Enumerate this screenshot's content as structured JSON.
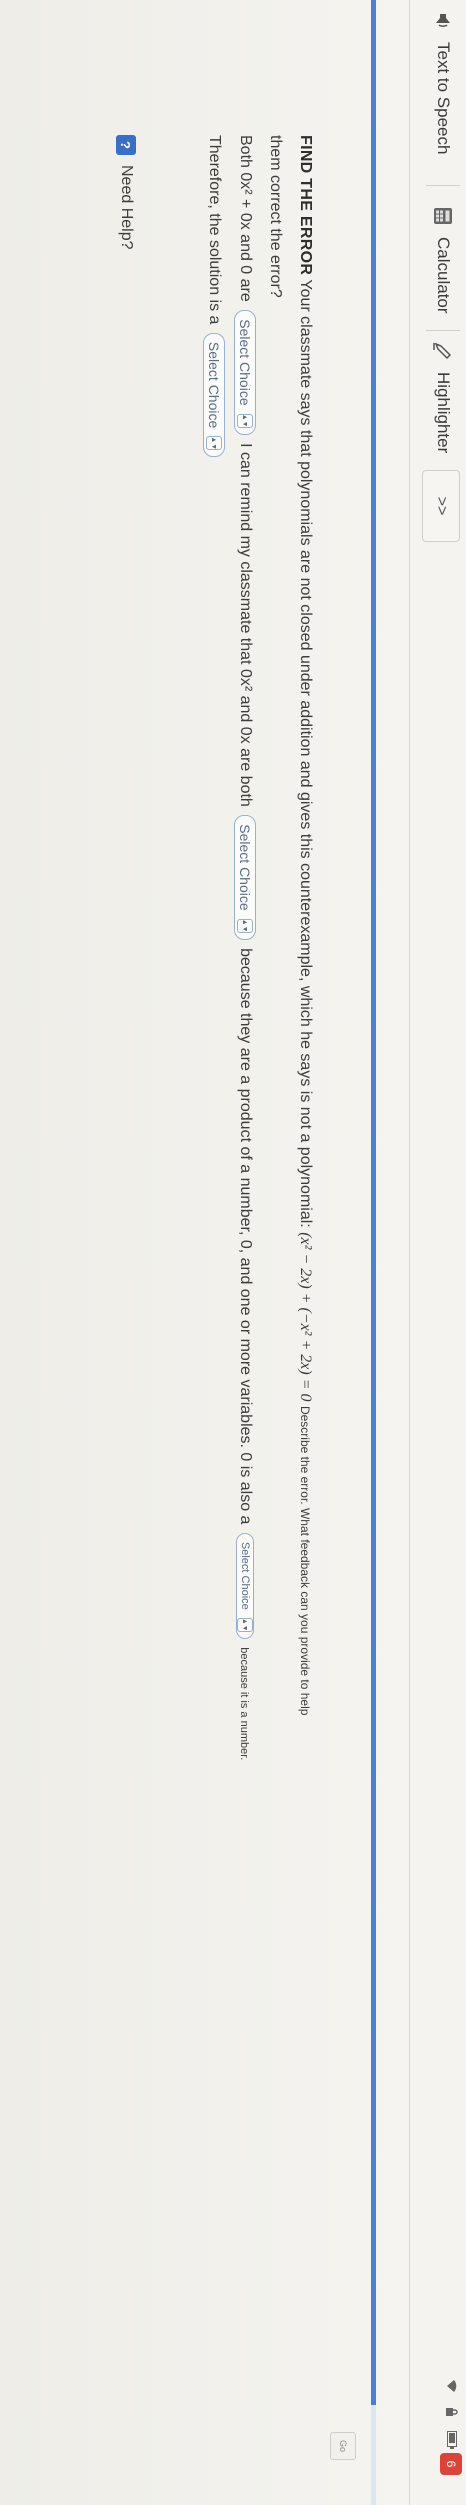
{
  "toolbar": {
    "text_to_speech": "Text to Speech",
    "calculator": "Calculator",
    "highlighter": "Highlighter",
    "more": ">>"
  },
  "status": {
    "icons": [
      "wifi-icon",
      "lock-icon",
      "battery-icon"
    ],
    "alert": "6"
  },
  "progress": {
    "fraction": 0.96,
    "color": "#4a7fd4"
  },
  "side_tab": "Go",
  "question": {
    "heading": "FIND THE ERROR",
    "prompt": "Your classmate says that polynomials are not closed under addition and gives this counterexample, which he says is not a polynomial:",
    "expression": "(x² − 2x) + (−x² + 2x) = 0",
    "prompt_end": "Describe the error. What feedback can you provide to help",
    "prompt_line2": "them correct the error?",
    "line3_a": "Both 0x² + 0x and 0 are",
    "line3_b": "I can remind my classmate that 0x² and 0x are both",
    "line3_c": "because they are a product of a number, 0, and one or more variables. 0 is also a",
    "line3_d": "because it is a number.",
    "line4_a": "Therefore, the solution is a",
    "select_label": "Select Choice",
    "caret": "▲▼"
  },
  "help": {
    "label": "Need Help?",
    "icon": "?"
  }
}
